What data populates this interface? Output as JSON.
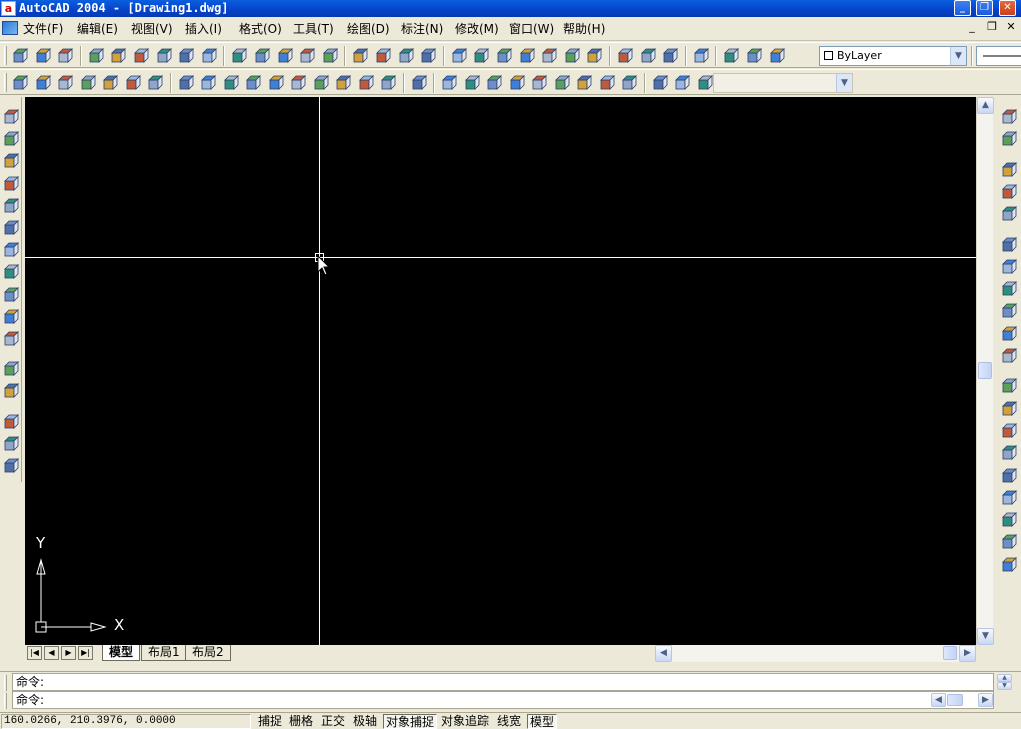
{
  "window": {
    "title": "AutoCAD 2004 - [Drawing1.dwg]",
    "app_icon_glyph": "a",
    "controls": {
      "minimize": "_",
      "restore": "❐",
      "close": "✕"
    }
  },
  "menu": {
    "items": [
      "文件(F)",
      "编辑(E)",
      "视图(V)",
      "插入(I)",
      "格式(O)",
      "工具(T)",
      "绘图(D)",
      "标注(N)",
      "修改(M)",
      "窗口(W)",
      "帮助(H)"
    ],
    "mdi_controls": {
      "minimize": "_",
      "restore": "❐",
      "close": "✕"
    }
  },
  "toolbar": {
    "layer_combo": "ByLayer",
    "empty_combo": ""
  },
  "colors": {
    "canvas_bg": "#000000",
    "crosshair": "#FFFFFF",
    "title_bar": "#0A5FE0",
    "chrome": "#ECE9D8"
  },
  "canvas": {
    "ucs_x_label": "X",
    "ucs_y_label": "Y"
  },
  "tabs": {
    "nav_first": "|◀",
    "nav_prev": "◀",
    "nav_next": "▶",
    "nav_last": "▶|",
    "items": [
      "模型",
      "布局1",
      "布局2"
    ],
    "active": "模型"
  },
  "command": {
    "line1": "命令:",
    "line2": "命令:"
  },
  "status": {
    "coordinates": "160.0266, 210.3976, 0.0000",
    "toggles": [
      {
        "label": "捕捉",
        "on": false
      },
      {
        "label": "栅格",
        "on": false
      },
      {
        "label": "正交",
        "on": false
      },
      {
        "label": "极轴",
        "on": false
      },
      {
        "label": "对象捕捉",
        "on": true
      },
      {
        "label": "对象追踪",
        "on": false
      },
      {
        "label": "线宽",
        "on": false
      },
      {
        "label": "模型",
        "on": true
      }
    ]
  },
  "icons": {
    "top_row1": [
      "union-icon",
      "subtract-icon",
      "intersect-icon",
      "box-3d-icon",
      "extrude-face-icon",
      "move-face-icon",
      "delete-face-icon",
      "rotate-face-icon",
      "offset-face-icon",
      "copy-face-icon",
      "color-face-icon",
      "copy-edge-icon",
      "color-edge-icon",
      "imprint-icon",
      "clean-icon",
      "separate-icon",
      "shell-icon",
      "check-icon",
      "box-icon",
      "sphere-icon",
      "cylinder-icon",
      "cone-icon",
      "wedge-icon",
      "torus-icon",
      "extrude-icon",
      "revolve-icon",
      "slice-icon",
      "section-icon",
      "interfere-icon",
      "setup-drawing-icon",
      "setup-view-icon",
      "setup-profile-icon"
    ],
    "top_row2": [
      "ucs-icon",
      "ucs-world-icon",
      "ucs-prev-icon",
      "ucs-object-icon",
      "ucs-face-icon",
      "ucs-view-icon",
      "ucs-origin-icon",
      "top-view-icon",
      "bottom-view-icon",
      "left-view-icon",
      "right-view-icon",
      "front-view-icon",
      "back-view-icon",
      "sw-iso-icon",
      "se-iso-icon",
      "ne-iso-icon",
      "nw-iso-icon",
      "camera-icon",
      "3d-orbit-icon",
      "pan-icon",
      "zoom-icon",
      "swivel-icon",
      "adjust-distance-icon",
      "continuous-orbit-icon",
      "clip-icon",
      "front-clip-icon",
      "back-clip-icon",
      "viewport-single-icon",
      "viewport-2-icon",
      "viewport-3-icon",
      "viewport-4-icon"
    ],
    "left": [
      "3d-polyline-icon",
      "3d-face-icon",
      "box-surface-icon",
      "wedge-surface-icon",
      "pyramid-icon",
      "cone-surface-icon",
      "sphere-surface-icon",
      "dome-icon",
      "dish-icon",
      "torus-surface-icon",
      "edge-icon",
      "3d-mesh-icon",
      "revolved-surface-icon",
      "tabulated-surface-icon",
      "ruled-surface-icon",
      "edge-surface-icon"
    ],
    "right": [
      "text-style-icon",
      "dim-style-icon",
      "layer-icon",
      "layer-prev-icon",
      "layer-state-icon",
      "render-icon",
      "scene-icon",
      "light-icon",
      "material-icon",
      "landscape-icon",
      "fog-icon",
      "background-icon",
      "materials-lib-icon",
      "mapping-icon",
      "landscape-new-icon",
      "landscape-edit-icon",
      "landscape-lib-icon",
      "render-prefs-icon",
      "statistics-icon",
      "hide-icon"
    ]
  }
}
